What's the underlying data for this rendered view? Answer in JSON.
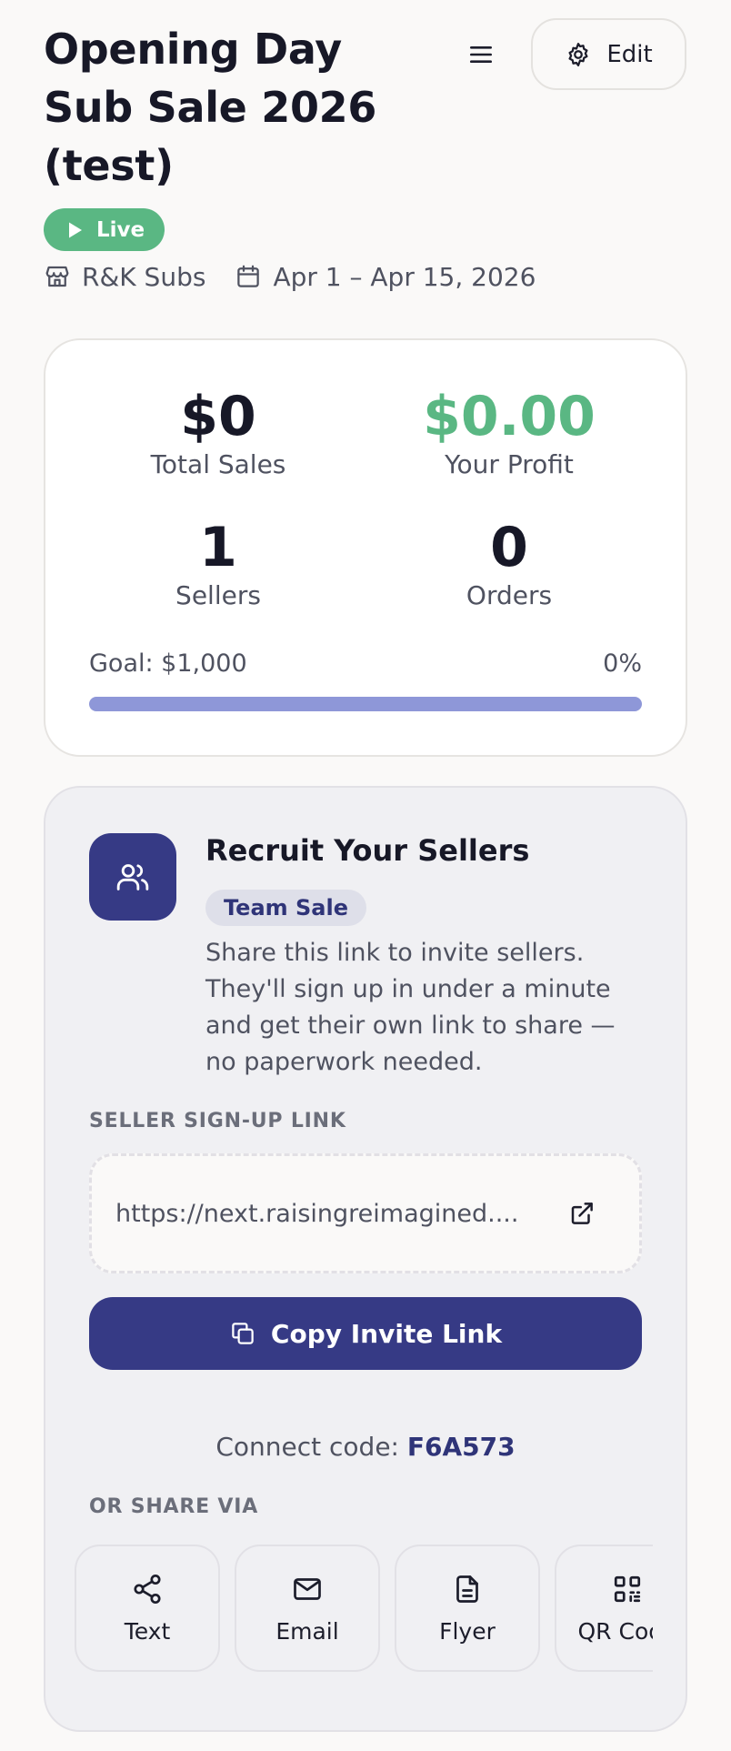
{
  "header": {
    "title": "Opening Day Sub Sale 2026 (test)",
    "menu_icon": "hamburger-menu-icon",
    "edit_label": "Edit",
    "edit_icon": "gear-icon"
  },
  "status": {
    "label": "Live",
    "color": "#5ab783"
  },
  "meta": {
    "organization": "R&K Subs",
    "date_range": "Apr 1 – Apr 15, 2026"
  },
  "stats": {
    "total_sales_value": "$0",
    "total_sales_label": "Total Sales",
    "profit_value": "$0.00",
    "profit_label": "Your Profit",
    "sellers_value": "1",
    "sellers_label": "Sellers",
    "orders_value": "0",
    "orders_label": "Orders",
    "goal_label": "Goal: $1,000",
    "goal_percent_label": "0%",
    "goal_progress": 0
  },
  "recruit": {
    "title": "Recruit Your Sellers",
    "badge": "Team Sale",
    "description": "Share this link to invite sellers. They'll sign up in under a minute and get their own link to share — no paperwork needed.",
    "link_section_label": "SELLER SIGN-UP LINK",
    "link_display": "https://next.raisingreimagined....",
    "copy_button_label": "Copy Invite Link",
    "connect_code_label": "Connect code:",
    "connect_code": "F6A573",
    "share_section_label": "OR SHARE VIA",
    "share_options": [
      {
        "label": "Text",
        "icon": "share-icon"
      },
      {
        "label": "Email",
        "icon": "mail-icon"
      },
      {
        "label": "Flyer",
        "icon": "document-icon"
      },
      {
        "label": "QR Code",
        "icon": "qr-code-icon"
      }
    ]
  },
  "colors": {
    "accent": "#363a85",
    "success": "#5ab783",
    "progress_track": "#8e97d8"
  }
}
